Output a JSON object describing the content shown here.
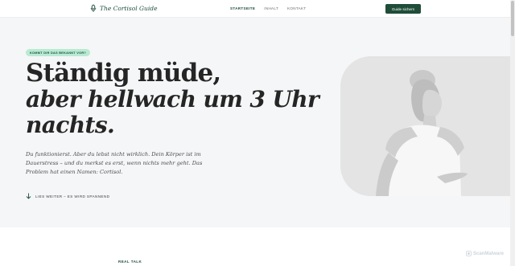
{
  "header": {
    "logo_icon": "leaf-ornament-icon",
    "logo_text": "The Cortisol Guide",
    "nav": [
      {
        "label": "STARTSEITE",
        "active": true
      },
      {
        "label": "INHALT",
        "active": false
      },
      {
        "label": "KONTAKT",
        "active": false
      }
    ],
    "cta_label": "Guide sichern"
  },
  "hero": {
    "badge": "KOMMT DIR DAS BEKANNT VOR?",
    "headline_line1": "Ständig müde,",
    "headline_line2": "aber hellwach um 3 Uhr",
    "headline_line3": "nachts.",
    "lead": "Du funktionierst. Aber du lebst nicht wirklich. Dein Körper ist im Dauerstress – und du merkst es erst, wenn nichts mehr geht. Das Problem hat einen Namen: Cortisol.",
    "scroll_icon": "arrow-down-icon",
    "scroll_link": "LIES WEITER – ES WIRD SPANNEND",
    "image_subject": "woman-meditating-illustration"
  },
  "next_section": {
    "label": "REAL TALK"
  },
  "watermark": {
    "text": "ScanMalware",
    "icon": "scanmalware-logo-icon"
  },
  "colors": {
    "brand_green": "#1f4d3a",
    "badge_bg": "#b9ead3",
    "hero_bg": "#f5f6f7",
    "image_bg": "#e4e4e4"
  }
}
